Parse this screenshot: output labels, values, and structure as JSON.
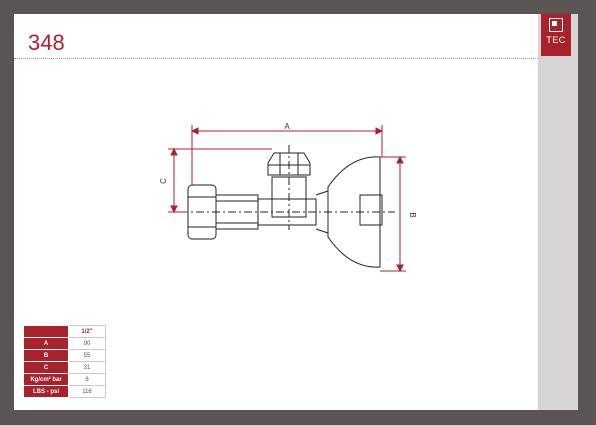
{
  "product_code": "348",
  "logo": {
    "text": "TEC",
    "color": "#a8222c"
  },
  "drawing": {
    "dim_a": "A",
    "dim_b": "B",
    "dim_c": "C"
  },
  "spec_table": {
    "header": "1/2\"",
    "rows": [
      {
        "label": "A",
        "value": "90"
      },
      {
        "label": "B",
        "value": "55"
      },
      {
        "label": "C",
        "value": "31"
      },
      {
        "label": "Kg/cm² bar",
        "value": "8"
      },
      {
        "label": "LBS - psi",
        "value": "116"
      }
    ]
  }
}
